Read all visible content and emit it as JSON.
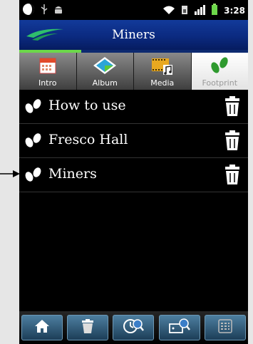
{
  "status_bar": {
    "time": "3:28"
  },
  "header": {
    "title": "Miners"
  },
  "progress": {
    "fraction": 0.27
  },
  "tabs": [
    {
      "label": "Intro",
      "icon": "calendar-icon",
      "active": false
    },
    {
      "label": "Album",
      "icon": "album-icon",
      "active": false
    },
    {
      "label": "Media",
      "icon": "media-icon",
      "active": false
    },
    {
      "label": "Footprint",
      "icon": "footprint-icon",
      "active": true
    }
  ],
  "list": {
    "items": [
      {
        "label": "How to use"
      },
      {
        "label": "Fresco Hall"
      },
      {
        "label": "Miners"
      }
    ]
  },
  "bottom_bar": {
    "buttons": [
      {
        "icon": "home-icon"
      },
      {
        "icon": "trash-icon"
      },
      {
        "icon": "clock-search-icon"
      },
      {
        "icon": "map-search-icon"
      },
      {
        "icon": "keypad-icon"
      }
    ]
  },
  "colors": {
    "header_bg": "#0b2a80",
    "progress_fill": "#6cd84a",
    "footprint_green": "#2f9a2f",
    "button_blue": "#2f5d7e"
  }
}
